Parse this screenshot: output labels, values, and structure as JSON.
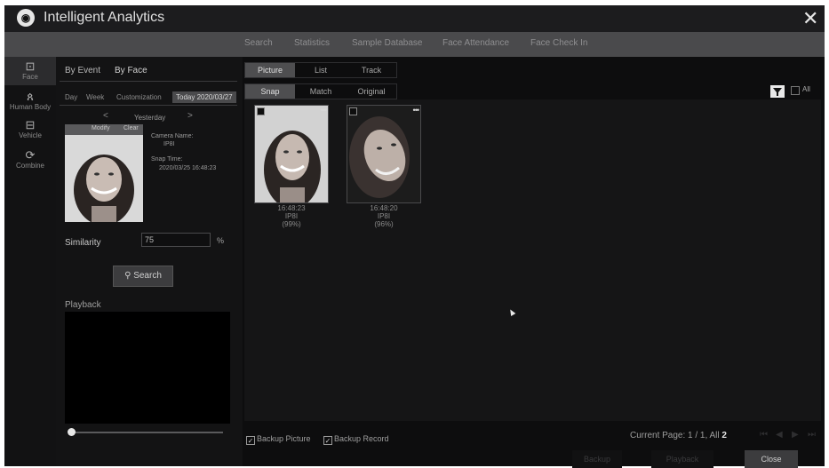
{
  "window": {
    "title": "Intelligent Analytics",
    "close_label": "✕",
    "logo_text": "◉"
  },
  "top_nav": [
    "Search",
    "Statistics",
    "Sample Database",
    "Face Attendance",
    "Face Check In"
  ],
  "sidebar": [
    {
      "icon": "face-icon",
      "glyph": "⊡",
      "label": "Face",
      "active": true
    },
    {
      "icon": "human-body-icon",
      "glyph": "ጰ",
      "label": "Human Body",
      "active": false
    },
    {
      "icon": "vehicle-icon",
      "glyph": "⊟",
      "label": "Vehicle",
      "active": false
    },
    {
      "icon": "combine-icon",
      "glyph": "⟳",
      "label": "Combine",
      "active": false
    }
  ],
  "search_tabs": {
    "by_event": "By Event",
    "by_face": "By Face"
  },
  "date_tabs": [
    "Day",
    "Week",
    "Customization",
    "Today 2020/03/27"
  ],
  "day_nav": {
    "prev": "<",
    "label": "Yesterday",
    "next": ">"
  },
  "face_card": {
    "modify": "Modify",
    "clear": "Clear",
    "camera_name_label": "Camera Name:",
    "camera_name": "IP8I",
    "snap_time_label": "Snap Time:",
    "snap_time": "2020/03/25 16:48:23"
  },
  "similarity": {
    "label": "Similarity",
    "value": "75",
    "unit": "%"
  },
  "search_button": {
    "icon": "search-icon",
    "label": "Search"
  },
  "playback": {
    "label": "Playback"
  },
  "view_modes": [
    "Picture",
    "List",
    "Track"
  ],
  "image_modes": [
    "Snap",
    "Match",
    "Original"
  ],
  "filter": {
    "icon": "filter-icon",
    "all_label": "All"
  },
  "results": [
    {
      "time": "16:48:23",
      "camera": "IP8I",
      "score": "(99%)"
    },
    {
      "time": "16:48:20",
      "camera": "IP8I",
      "score": "(96%)"
    }
  ],
  "bottom_options": {
    "backup_picture": "Backup Picture",
    "backup_record": "Backup Record"
  },
  "pagination": {
    "prefix": "Current Page: 1 / 1, All",
    "total": "2"
  },
  "buttons": {
    "backup": "Backup",
    "playback": "Playback",
    "close": "Close"
  },
  "colors": {
    "accent_bg": "#4a4a4c",
    "window_bg": "#0f0f10",
    "text": "#c8c8c8"
  }
}
